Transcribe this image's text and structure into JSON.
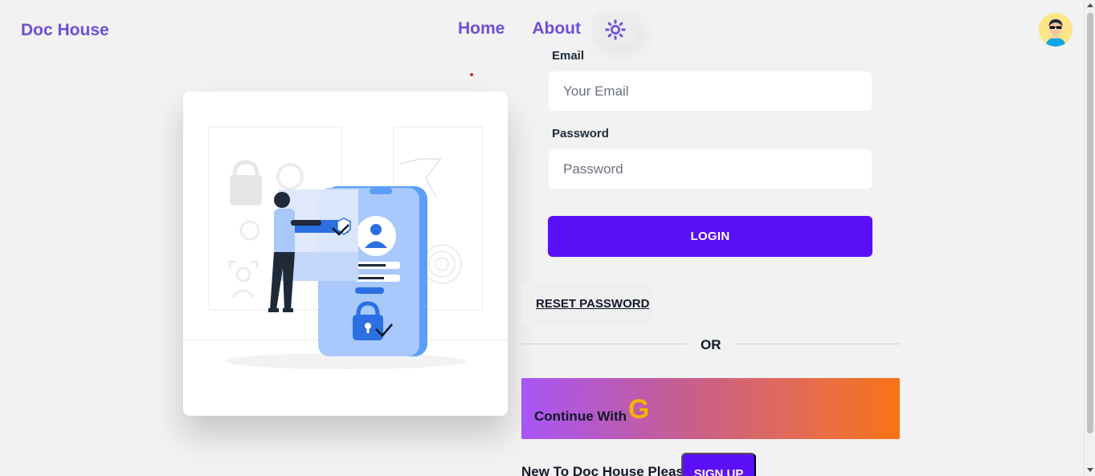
{
  "brand": "Doc House",
  "nav": {
    "home": "Home",
    "about": "About"
  },
  "icons": {
    "theme": "sun-icon",
    "avatar": "user-avatar",
    "google": "google-g-icon"
  },
  "colors": {
    "brand": "#6d4fd8",
    "primary": "#5b0ff7",
    "google_gradient_start": "#a855f7",
    "google_gradient_end": "#f97316"
  },
  "form": {
    "email_label": "Email",
    "email_placeholder": "Your Email",
    "password_label": "Password",
    "password_placeholder": "Password",
    "login_label": "LOGIN",
    "reset_label": "RESET PASSWORD",
    "or_label": "OR",
    "google_label": "Continue With",
    "google_glyph": "G",
    "signup_prompt": "New To Doc House Please",
    "signup_label": "SIGN UP"
  }
}
